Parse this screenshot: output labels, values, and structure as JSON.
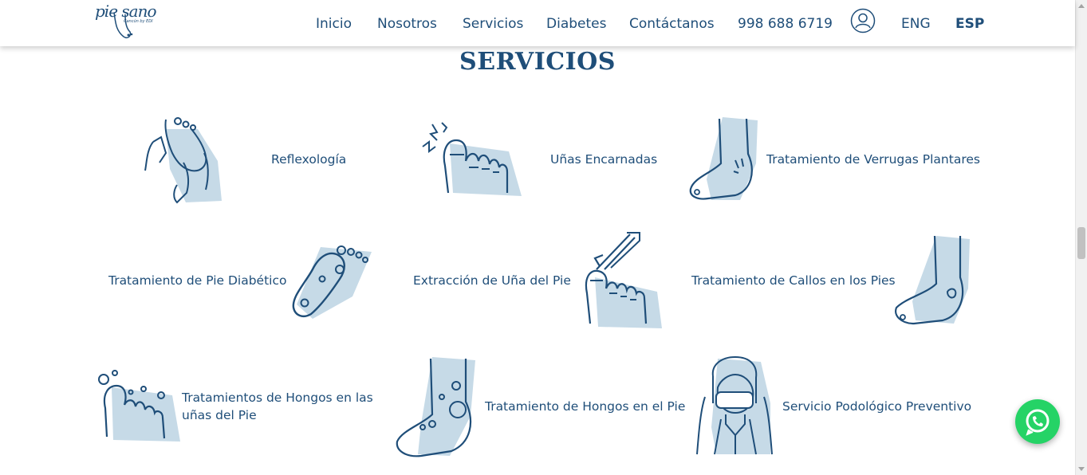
{
  "header": {
    "logo": {
      "text": "pie sano",
      "subtitle": "Cancún by EDI"
    },
    "nav": [
      {
        "label": "Inicio"
      },
      {
        "label": "Nosotros"
      },
      {
        "label": "Servicios"
      },
      {
        "label": "Diabetes"
      },
      {
        "label": "Contáctanos"
      },
      {
        "label": "998 688 6719"
      },
      {
        "label": "ENG"
      },
      {
        "label": "ESP"
      }
    ],
    "user_icon": "user-circle-icon"
  },
  "section": {
    "title": "SERVICIOS"
  },
  "services": [
    {
      "label": "Reflexología",
      "icon": "foot-massage-icon"
    },
    {
      "label": "Uñas Encarnadas",
      "icon": "ingrown-toenail-icon"
    },
    {
      "label": "Tratamiento de Verrugas Plantares",
      "icon": "plantar-wart-foot-icon"
    },
    {
      "label": "Tratamiento de Pie Diabético",
      "icon": "diabetic-foot-sole-icon"
    },
    {
      "label": "Extracción de Uña del Pie",
      "icon": "nail-extraction-icon"
    },
    {
      "label": "Tratamiento de Callos en los Pies",
      "icon": "callus-foot-icon"
    },
    {
      "label": "Tratamientos de Hongos en las uñas del Pie",
      "icon": "nail-fungus-icon"
    },
    {
      "label": "Tratamiento de Hongos en el Pie",
      "icon": "foot-fungus-icon"
    },
    {
      "label": "Servicio Podológico Preventivo",
      "icon": "podiatrist-icon"
    }
  ],
  "colors": {
    "primary": "#1f4e79",
    "accent_light": "#c6dae7",
    "whatsapp": "#25d366"
  },
  "whatsapp": {
    "icon": "whatsapp-icon"
  }
}
